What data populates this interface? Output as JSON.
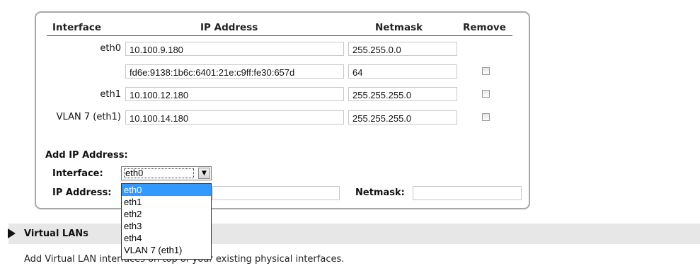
{
  "table": {
    "headers": {
      "interface": "Interface",
      "ip": "IP Address",
      "netmask": "Netmask",
      "remove": "Remove"
    },
    "rows": [
      {
        "interface": "eth0",
        "ip": "10.100.9.180",
        "netmask": "255.255.0.0",
        "removable": false
      },
      {
        "interface": "",
        "ip": "fd6e:9138:1b6c:6401:21e:c9ff:fe30:657d",
        "netmask": "64",
        "removable": true
      },
      {
        "interface": "eth1",
        "ip": "10.100.12.180",
        "netmask": "255.255.255.0",
        "removable": true
      },
      {
        "interface": "VLAN 7 (eth1)",
        "ip": "10.100.14.180",
        "netmask": "255.255.255.0",
        "removable": true
      }
    ]
  },
  "add": {
    "title": "Add IP Address:",
    "interface_label": "Interface:",
    "interface_selected": "eth0",
    "ip_label": "IP Address:",
    "ip_value": "",
    "netmask_label": "Netmask:",
    "netmask_value": "",
    "options": [
      "eth0",
      "eth1",
      "eth2",
      "eth3",
      "eth4",
      "VLAN 7 (eth1)"
    ]
  },
  "vlan": {
    "title": "Virtual LANs",
    "description": "Add Virtual LAN interfaces on top of your existing physical interfaces."
  },
  "colors": {
    "panel_border": "#a8a8a8",
    "section_bar": "#e7e7e7",
    "option_highlight": "#3399ff"
  }
}
